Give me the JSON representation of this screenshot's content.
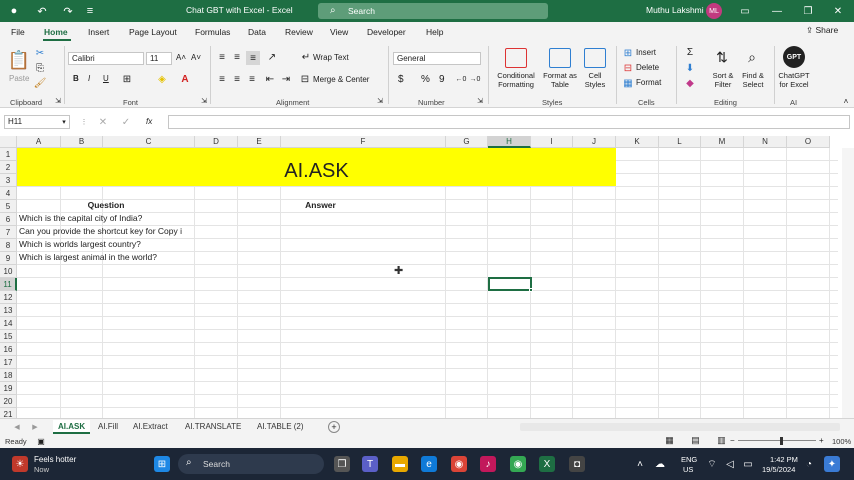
{
  "window": {
    "title": "Chat GBT with Excel  -  Excel",
    "search_placeholder": "Search",
    "user_name": "Muthu Lakshmi",
    "user_initials": "ML"
  },
  "ribbon_tabs": [
    "File",
    "Home",
    "Insert",
    "Page Layout",
    "Formulas",
    "Data",
    "Review",
    "View",
    "Developer",
    "Help"
  ],
  "active_tab": "Home",
  "share_label": "Share",
  "ribbon": {
    "clipboard": {
      "label": "Clipboard",
      "paste": "Paste"
    },
    "font": {
      "label": "Font",
      "name": "Calibri",
      "size": "11",
      "bold": "B",
      "italic": "I",
      "underline": "U"
    },
    "alignment": {
      "label": "Alignment",
      "wrap": "Wrap Text",
      "merge": "Merge & Center"
    },
    "number": {
      "label": "Number",
      "format": "General",
      "currency": "$",
      "percent": "%",
      "comma": "9"
    },
    "styles": {
      "label": "Styles",
      "conditional": "Conditional Formatting",
      "format_table": "Format as Table",
      "cell_styles": "Cell Styles"
    },
    "cells": {
      "label": "Cells",
      "insert": "Insert",
      "delete": "Delete",
      "format": "Format"
    },
    "editing": {
      "label": "Editing",
      "sort": "Sort & Filter",
      "find": "Find & Select"
    },
    "ai": {
      "label": "AI",
      "chatgpt": "ChatGPT for Excel",
      "gpt_icon_text": "GPT"
    }
  },
  "formula_bar": {
    "name_box": "H11",
    "fx": "fx",
    "value": ""
  },
  "columns": [
    "A",
    "B",
    "C",
    "D",
    "E",
    "F",
    "G",
    "H",
    "I",
    "J",
    "K",
    "L",
    "M",
    "N",
    "O"
  ],
  "selected_column": "H",
  "rows": [
    "1",
    "2",
    "3",
    "4",
    "5",
    "6",
    "7",
    "8",
    "9",
    "10",
    "11",
    "12",
    "13",
    "14",
    "15",
    "16",
    "17",
    "18",
    "19",
    "20",
    "21"
  ],
  "selected_row": "11",
  "sheet": {
    "banner_title": "AI.ASK",
    "question_header": "Question",
    "answer_header": "Answer",
    "questions": [
      "Which is the capital city of India?",
      "Can you provide the shortcut key for Copy i",
      "Which is worlds largest country?",
      "Which is largest animal in the world?"
    ]
  },
  "sheet_tabs": [
    "AI.ASK",
    "AI.Fill",
    "AI.Extract",
    "AI.TRANSLATE",
    "AI.TABLE (2)"
  ],
  "active_sheet": "AI.ASK",
  "status": {
    "ready": "Ready",
    "zoom": "100%"
  },
  "taskbar": {
    "weather_line1": "Feels hotter",
    "weather_line2": "Now",
    "search": "Search",
    "lang1": "ENG",
    "lang2": "US",
    "time": "1:42 PM",
    "date": "19/5/2024"
  },
  "colors": {
    "excel_green": "#1e6e43",
    "banner_yellow": "#ffff00",
    "taskbar_bg": "#1c2636"
  }
}
